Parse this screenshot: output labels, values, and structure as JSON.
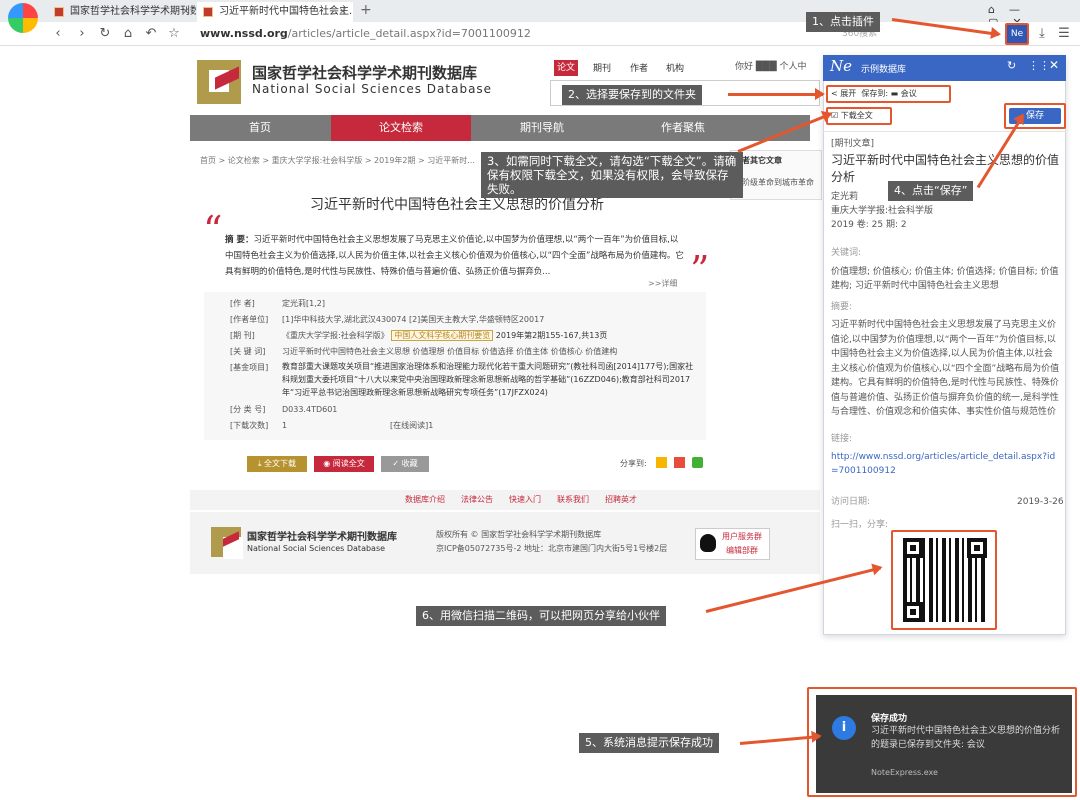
{
  "browser": {
    "tabs": [
      {
        "label": "国家哲学社会科学学术期刊数..."
      },
      {
        "label": "习近平新时代中国特色社会主..."
      }
    ],
    "url_domain": "www.nssd.org",
    "url_path": "/articles/article_detail.aspx?id=7001100912",
    "search_placeholder": "360搜索"
  },
  "site": {
    "title_cn": "国家哲学社会科学学术期刊数据库",
    "title_en": "National  Social  Sciences  Database",
    "search_tabs": [
      "论文",
      "期刊",
      "作者",
      "机构"
    ],
    "user_text": "你好 ███ 个人中",
    "nav": [
      "首页",
      "论文检索",
      "期刊导航",
      "作者聚焦"
    ],
    "breadcrumb": "首页 > 论文检索 > 重庆大学学报:社会科学版 > 2019年2期 > 习近平新时...",
    "article_title": "习近平新时代中国特色社会主义思想的价值分析",
    "abstract_label": "摘    要：",
    "abstract": "习近平新时代中国特色社会主义思想发展了马克思主义价值论,以中国梦为价值理想,以“两个一百年”为价值目标,以中国特色社会主义为价值选择,以人民为价值主体,以社会主义核心价值观为价值核心,以“四个全面”战略布局为价值建构。它具有鲜明的价值特色,是时代性与民族性、特殊价值与普遍价值、弘扬正价值与摒弃负...",
    "more_link": ">>详细",
    "meta": [
      {
        "label": "[作    者]",
        "value": "定光莉[1,2]"
      },
      {
        "label": "[作者单位]",
        "value": "[1]华中科技大学,湖北武汉430074 [2]美国天主教大学,华盛顿特区20017"
      },
      {
        "label": "[期    刊]",
        "value": "《重庆大学学报:社会科学版》",
        "badge": "中国人文科学核心期刊要览",
        "extra": "2019年第2期155-167,共13页"
      },
      {
        "label": "[关 键 词]",
        "value": "习近平新时代中国特色社会主义思想 价值理想 价值目标 价值选择 价值主体 价值核心 价值建构"
      },
      {
        "label": "[基金项目]",
        "value": "教育部重大课题攻关项目“推进国家治理体系和治理能力现代化若干重大问题研究”(教社科司函[2014]177号);国家社科规划重大委托项目“十八大以来党中央治国理政新理念新思想新战略的哲学基础”(16ZZD046);教育部社科司2017年“习近平总书记治国理政新理念新思想新战略研究专项任务”(17JFZX024)"
      },
      {
        "label": "[分 类 号]",
        "value": "D033.4TD601"
      },
      {
        "label": "[下载次数]",
        "value": "1",
        "label2": "[在线阅读]",
        "value2": "1"
      }
    ],
    "buttons": {
      "download": "全文下载",
      "read": "阅读全文",
      "collect": "收藏"
    },
    "share_label": "分享到:",
    "right_box_title": "作者其它文章",
    "right_box_item": "从阶级革命到城市革命",
    "footer_links": [
      "数据库介绍",
      "法律公告",
      "快速入门",
      "联系我们",
      "招聘英才"
    ],
    "footer_copy": "版权所有 © 国家哲学社会科学学术期刊数据库",
    "footer_icp": "京ICP备05072735号-2 地址：北京市建国门内大街5号1号楼2层",
    "footer_qq": [
      "用户服务群",
      "编辑部群"
    ]
  },
  "panel": {
    "title": "示例数据库",
    "expand": "< 展开",
    "save_to_label": "保存到:",
    "folder": "会议",
    "download_fulltext": "下载全文",
    "download_checked": true,
    "save_button": "保存",
    "type": "[期刊文章]",
    "title_text": "习近平新时代中国特色社会主义思想的价值分析",
    "author": "定光莉",
    "journal": "重庆大学学报:社会科学版",
    "year_line": "2019  卷: 25  期: 2",
    "keywords_label": "关键词:",
    "keywords": "价值理想; 价值核心; 价值主体; 价值选择; 价值目标; 价值建构; 习近平新时代中国特色社会主义思想",
    "abstract_label": "摘要:",
    "abstract": "习近平新时代中国特色社会主义思想发展了马克思主义价值论,以中国梦为价值理想,以“两个一百年”为价值目标,以中国特色社会主义为价值选择,以人民为价值主体,以社会主义核心价值观为价值核心,以“四个全面”战略布局为价值建构。它具有鲜明的价值特色,是时代性与民族性、特殊价值与普遍价值、弘扬正价值与摒弃负价值的统一,是科学性与合理性、价值观念和价值实体、事实性价值与规范性价值的有机统一。",
    "link_label": "链接:",
    "link": "http://www.nssd.org/articles/article_detail.aspx?id=7001100912",
    "date_label": "访问日期:",
    "date": "2019-3-26",
    "scan_label": "扫一扫，分享:"
  },
  "callouts": {
    "c1": "1、点击插件",
    "c2": "2、选择要保存到的文件夹",
    "c3": "3、如需同时下载全文，请勾选“下载全文”。请确保有权限下载全文，如果没有权限，会导致保存失败。",
    "c4": "4、点击“保存”",
    "c5": "5、系统消息提示保存成功",
    "c6": "6、用微信扫描二维码，可以把网页分享给小伙伴"
  },
  "toast": {
    "title": "保存成功",
    "body": "习近平新时代中国特色社会主义思想的价值分析的题录已保存到文件夹: 会议",
    "source": "NoteExpress.exe"
  },
  "colors": {
    "accent": "#e4572e",
    "brand_red": "#c6293b",
    "panel_blue": "#3b67c4"
  }
}
